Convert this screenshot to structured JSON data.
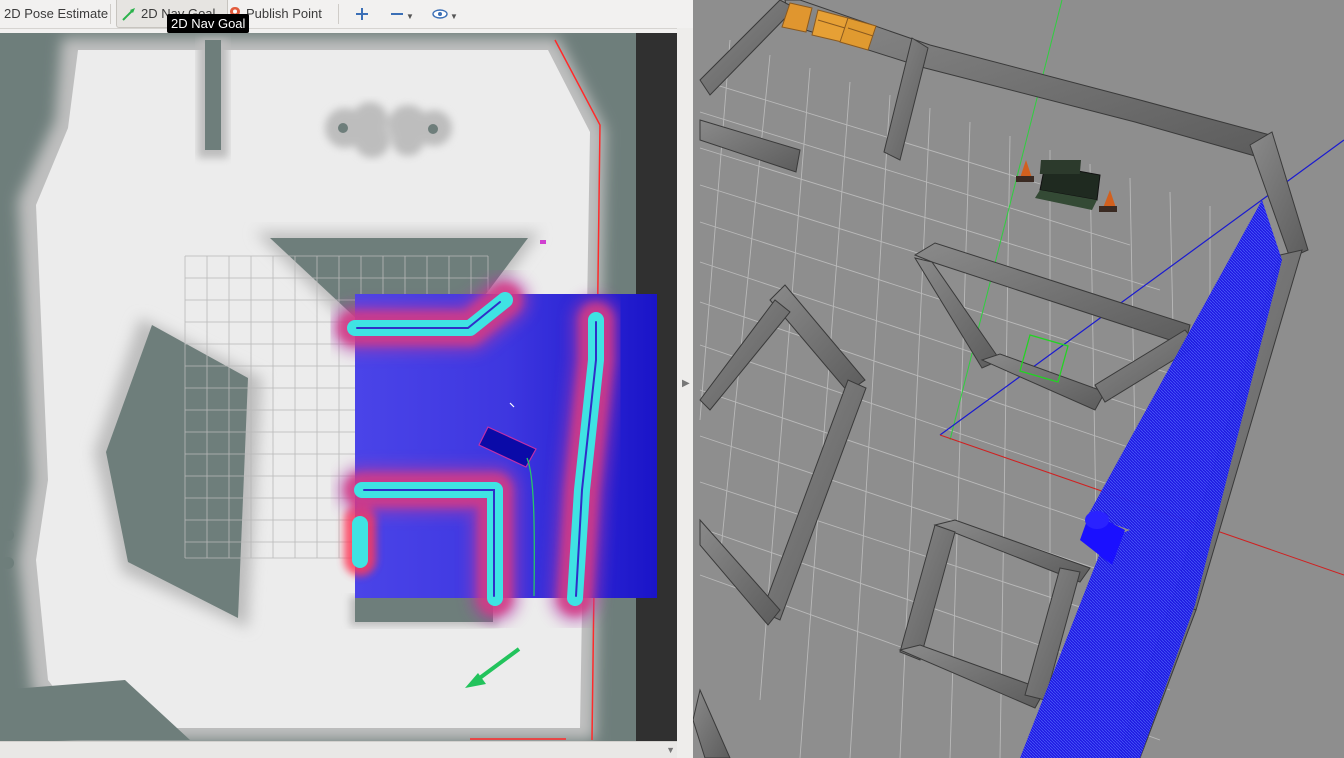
{
  "toolbar": {
    "pose_estimate": {
      "label": "2D Pose Estimate",
      "icon": "pose-estimate-icon"
    },
    "nav_goal": {
      "label": "2D Nav Goal",
      "icon": "green-arrow-icon",
      "active": true
    },
    "publish_point": {
      "label": "Publish Point",
      "icon": "map-pin-icon"
    },
    "add_tool": {
      "icon": "plus-icon"
    },
    "remove_tool": {
      "icon": "minus-icon"
    },
    "view_tool": {
      "icon": "eye-icon"
    }
  },
  "tooltip": {
    "text": "2D Nav Goal"
  },
  "colors": {
    "costmap_blue": "#3c35e6",
    "inflation_cyan": "#3fe3e3",
    "lethal_red": "#ff2a2a",
    "map_wall": "#6e7e7b",
    "map_free": "#f0f0f0",
    "gazebo_ground": "#8e8e8e",
    "laser_blue": "#1a14e8",
    "goal_arrow": "#22c35c"
  }
}
